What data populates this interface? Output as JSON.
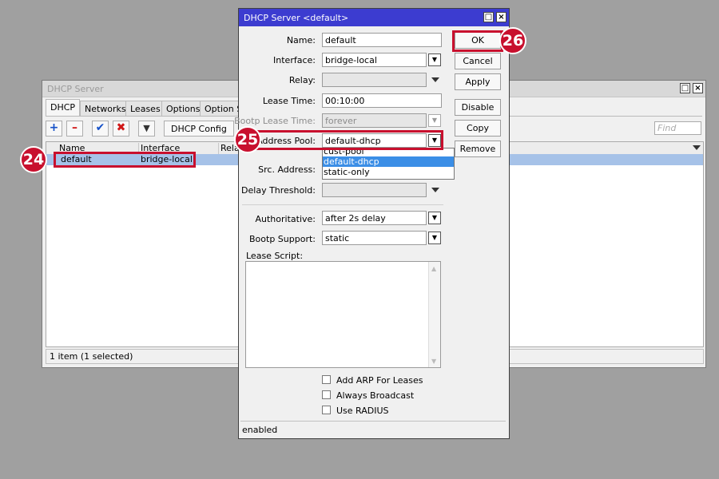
{
  "bg_window": {
    "title": "DHCP Server",
    "tabs": [
      "DHCP",
      "Networks",
      "Leases",
      "Options",
      "Option Se"
    ],
    "toolbar": {
      "config_label": "DHCP Config",
      "find_placeholder": "Find"
    },
    "columns": [
      "Name",
      "Interface",
      "Rela"
    ],
    "rows": [
      {
        "name": "default",
        "interface": "bridge-local"
      }
    ],
    "status": "1 item (1 selected)"
  },
  "dialog": {
    "title": "DHCP Server <default>",
    "fields": {
      "name": {
        "label": "Name:",
        "value": "default"
      },
      "interface": {
        "label": "Interface:",
        "value": "bridge-local"
      },
      "relay": {
        "label": "Relay:",
        "value": ""
      },
      "lease_time": {
        "label": "Lease Time:",
        "value": "00:10:00"
      },
      "bootp_lease_time": {
        "label": "Bootp Lease Time:",
        "value": "forever"
      },
      "address_pool": {
        "label": "Address Pool:",
        "value": "default-dhcp"
      },
      "src_address": {
        "label": "Src. Address:"
      },
      "delay_threshold": {
        "label": "Delay Threshold:",
        "value": ""
      },
      "authoritative": {
        "label": "Authoritative:",
        "value": "after 2s delay"
      },
      "bootp_support": {
        "label": "Bootp Support:",
        "value": "static"
      },
      "lease_script": {
        "label": "Lease Script:"
      }
    },
    "pool_options": [
      "cust-pool",
      "default-dhcp",
      "static-only"
    ],
    "pool_selected": "default-dhcp",
    "checkboxes": [
      "Add ARP For Leases",
      "Always Broadcast",
      "Use RADIUS"
    ],
    "buttons": [
      "OK",
      "Cancel",
      "Apply",
      "Disable",
      "Copy",
      "Remove"
    ],
    "status": "enabled"
  },
  "annotations": {
    "step_24": "24",
    "step_25": "25",
    "step_26": "26"
  },
  "colors": {
    "highlight": "#c8102e",
    "dialog_title_bar": "#3c3cd0",
    "selected_row": "#a6c2e8",
    "dropdown_selected": "#3b8ee6"
  }
}
